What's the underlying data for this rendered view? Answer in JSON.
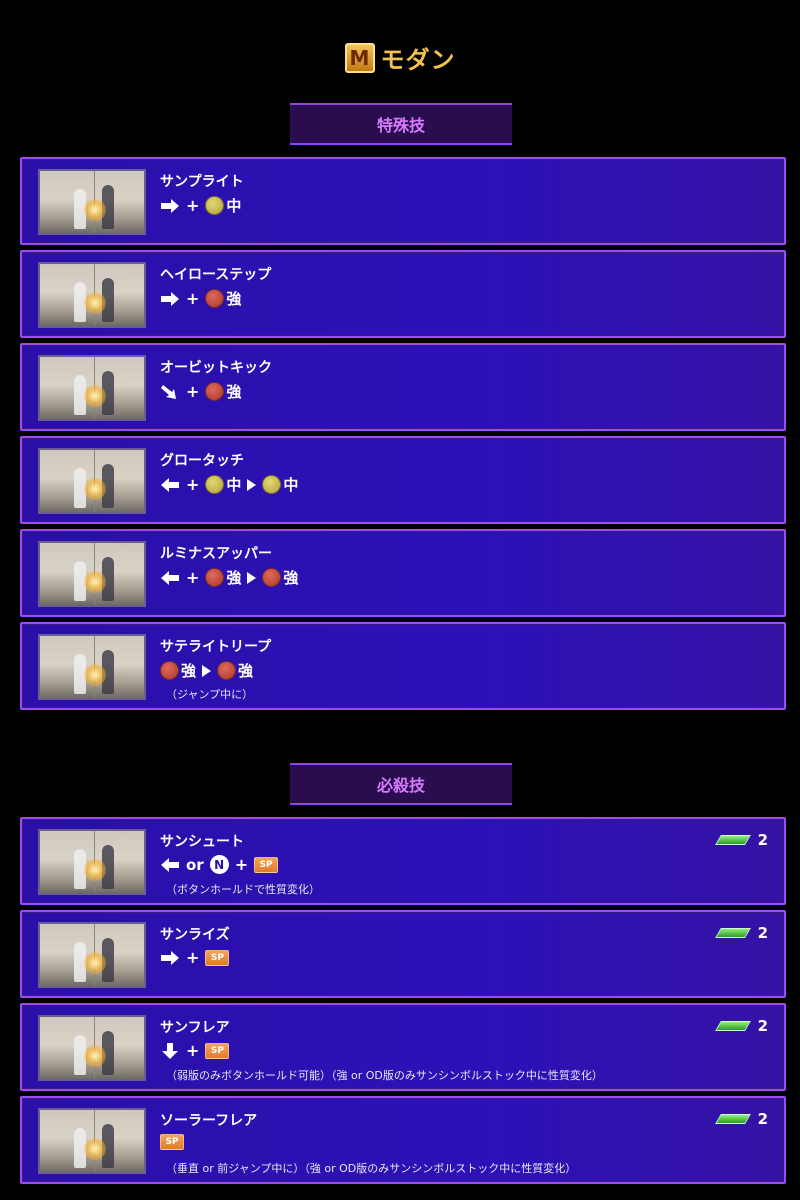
{
  "mode": {
    "badge": "M",
    "title": "モダン"
  },
  "sections": {
    "special": {
      "title": "特殊技",
      "moves": [
        {
          "name": "サンプライト",
          "note": ""
        },
        {
          "name": "ヘイローステップ",
          "note": ""
        },
        {
          "name": "オービットキック",
          "note": ""
        },
        {
          "name": "グロータッチ",
          "note": ""
        },
        {
          "name": "ルミナスアッパー",
          "note": ""
        },
        {
          "name": "サテライトリープ",
          "note": "（ジャンプ中に）"
        }
      ]
    },
    "super": {
      "title": "必殺技",
      "moves": [
        {
          "name": "サンシュート",
          "note": "（ボタンホールドで性質変化）",
          "gauge": "2"
        },
        {
          "name": "サンライズ",
          "note": "",
          "gauge": "2"
        },
        {
          "name": "サンフレア",
          "note": "（弱版のみボタンホールド可能）（強 or OD版のみサンシンボルストック中に性質変化）",
          "gauge": "2"
        },
        {
          "name": "ソーラーフレア",
          "note": "（垂直 or 前ジャンプ中に）（強 or OD版のみサンシンボルストック中に性質変化）",
          "gauge": "2"
        }
      ]
    }
  },
  "labels": {
    "plus": "+",
    "or": "or",
    "medium": "中",
    "heavy": "強",
    "neutral": "N",
    "sp": "SP"
  },
  "colors": {
    "card_bg": "#2d11b8",
    "card_border": "#9b4cf5",
    "section_text": "#d77bff",
    "mode_title": "#f2c14e"
  }
}
